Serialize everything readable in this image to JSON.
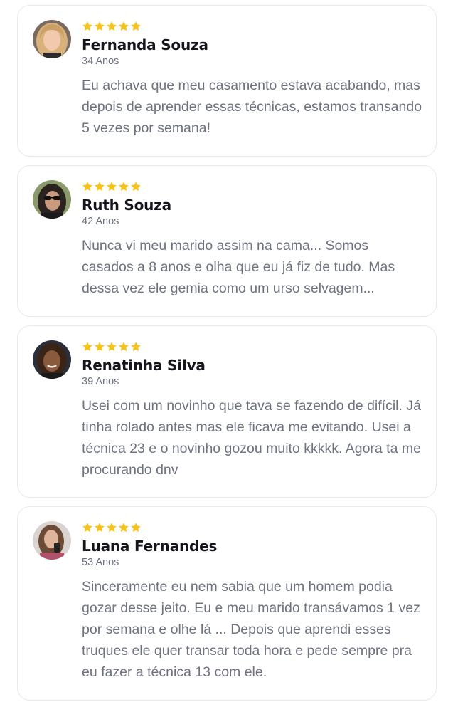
{
  "colors": {
    "star": "#f6c21b",
    "name": "#14161c",
    "muted": "#6d727e",
    "card_border": "#e8e9ee"
  },
  "reviews": [
    {
      "rating": 5,
      "avatar_icon": "woman-portrait-avatar",
      "name": "Fernanda Souza",
      "age": "34 Anos",
      "text": "Eu achava que meu casamento estava acabando, mas depois de aprender essas técnicas, estamos transando 5 vezes por semana!"
    },
    {
      "rating": 5,
      "avatar_icon": "woman-sunglasses-avatar",
      "name": "Ruth Souza",
      "age": "42 Anos",
      "text": "Nunca vi meu marido assim na cama... Somos casados a 8 anos e olha que eu já fiz de tudo. Mas dessa vez ele gemia como um urso selvagem..."
    },
    {
      "rating": 5,
      "avatar_icon": "woman-smiling-avatar",
      "name": "Renatinha Silva",
      "age": "39 Anos",
      "text": "Usei com um novinho que tava se fazendo de difícil. Já tinha rolado antes mas ele ficava me evitando. Usei a técnica 23 e o novinho gozou muito kkkkk. Agora ta me procurando dnv"
    },
    {
      "rating": 5,
      "avatar_icon": "woman-selfie-avatar",
      "name": "Luana Fernandes",
      "age": "53 Anos",
      "text": "Sinceramente eu nem sabia que um homem podia gozar desse jeito. Eu e meu marido transávamos 1 vez por semana e olhe lá ... Depois que aprendi esses truques ele quer transar toda hora e pede sempre pra eu fazer a técnica 13 com ele."
    }
  ]
}
